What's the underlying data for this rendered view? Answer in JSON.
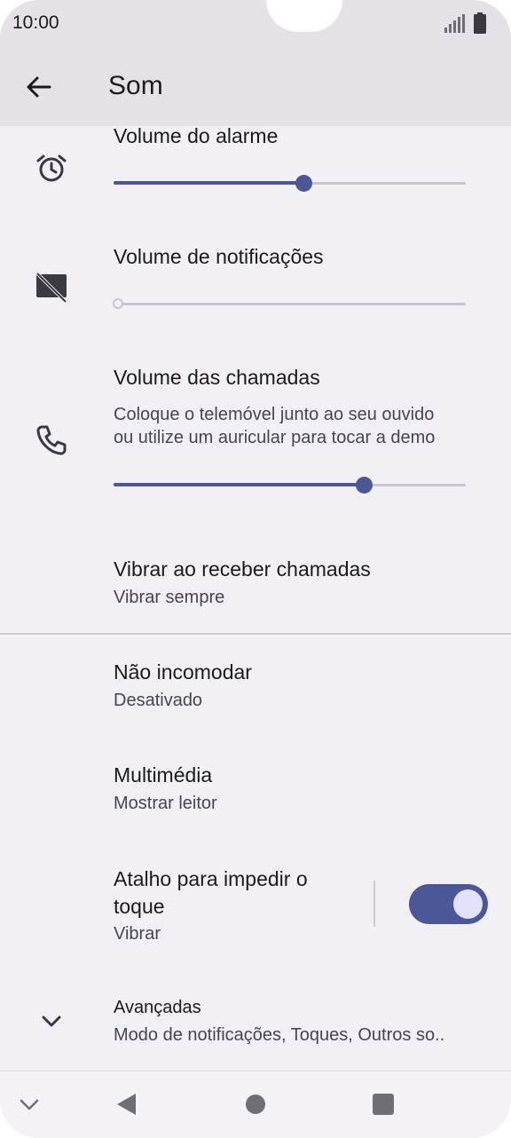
{
  "status_bar": {
    "time": "10:00"
  },
  "app_bar": {
    "title": "Som"
  },
  "settings": {
    "alarm_volume": {
      "title": "Volume do alarme",
      "level": 0.54
    },
    "notification_volume": {
      "title": "Volume de notificações",
      "level": 0.0
    },
    "call_volume": {
      "title": "Volume das chamadas",
      "description_line1": "Coloque o telemóvel junto ao seu ouvido",
      "description_line2": "ou utilize um auricular para tocar a demo",
      "level": 0.71
    },
    "vibrate_calls": {
      "title": "Vibrar ao receber chamadas",
      "value": "Vibrar sempre"
    },
    "do_not_disturb": {
      "title": "Não incomodar",
      "value": "Desativado"
    },
    "media": {
      "title": "Multimédia",
      "value": "Mostrar leitor"
    },
    "prevent_ringing": {
      "title_line1": "Atalho para impedir o",
      "title_line2": "toque",
      "value": "Vibrar",
      "enabled": true
    },
    "advanced": {
      "title": "Avançadas",
      "value": "Modo de notificações, Toques, Outros so.."
    }
  },
  "colors": {
    "accent": "#4b5797",
    "background": "#f2f0f4",
    "app_bar": "#e6e1e6"
  }
}
